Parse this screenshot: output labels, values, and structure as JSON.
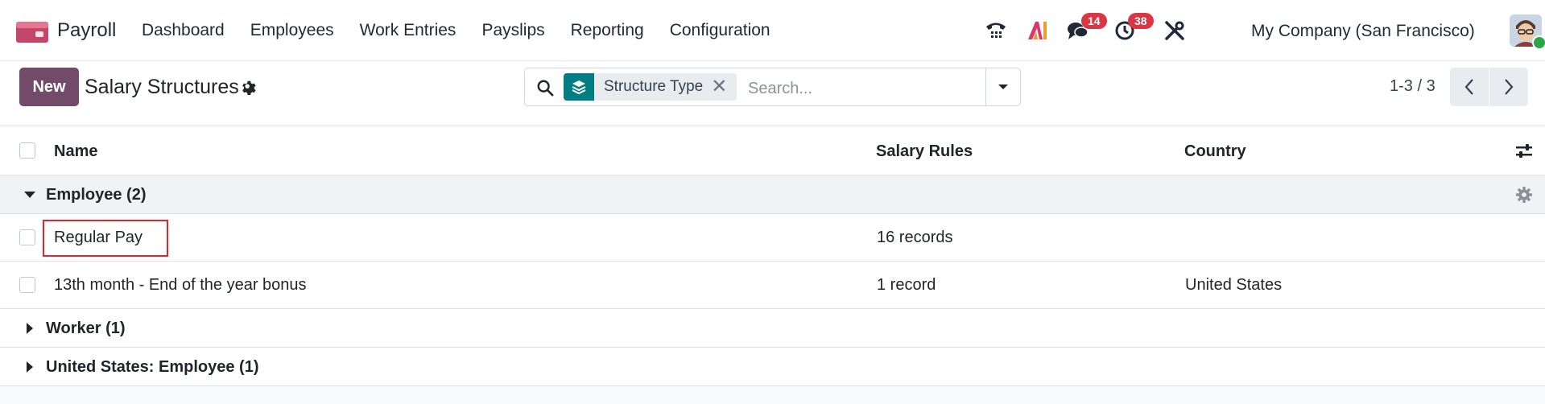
{
  "nav": {
    "app_name": "Payroll",
    "menu": [
      "Dashboard",
      "Employees",
      "Work Entries",
      "Payslips",
      "Reporting",
      "Configuration"
    ],
    "messages_count": "14",
    "activities_count": "38",
    "company": "My Company (San Francisco)",
    "icons": [
      "phone-icon",
      "ai-icon",
      "chat-icon",
      "clock-icon",
      "tools-icon"
    ]
  },
  "control": {
    "new_label": "New",
    "title": "Salary Structures",
    "facet_label": "Structure Type",
    "facet_remove": "✕",
    "search_placeholder": "Search...",
    "pager": "1-3 / 3"
  },
  "list": {
    "headers": {
      "name": "Name",
      "rules": "Salary Rules",
      "country": "Country"
    },
    "groups": [
      {
        "label": "Employee (2)",
        "expanded": true,
        "rows": [
          {
            "name": "Regular Pay",
            "rules": "16 records",
            "country": ""
          },
          {
            "name": "13th month - End of the year bonus",
            "rules": "1 record",
            "country": "United States"
          }
        ]
      },
      {
        "label": "Worker (1)",
        "expanded": false
      },
      {
        "label": "United States: Employee (1)",
        "expanded": false
      }
    ]
  },
  "colors": {
    "brand": "#714b67",
    "facet_accent": "#017e84",
    "badge": "#dc3545",
    "highlight_box": "#e0252b"
  }
}
